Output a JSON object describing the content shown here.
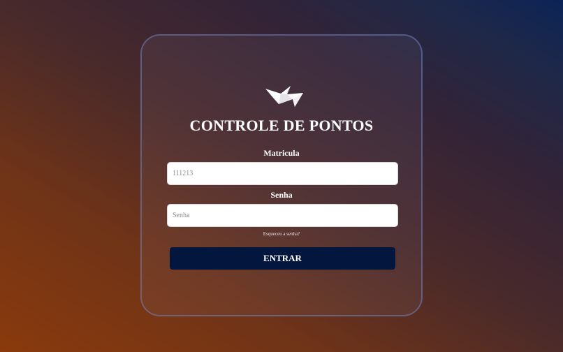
{
  "login": {
    "title": "CONTROLE DE PONTOS",
    "matricula_label": "Matricula",
    "matricula_value": "",
    "matricula_placeholder": "111213",
    "senha_label": "Senha",
    "senha_value": "",
    "senha_placeholder": "Senha",
    "forgot_link": "Esqueceu a senha?",
    "submit_label": "ENTRAR",
    "logo_icon": "paper-bird-logo-icon"
  },
  "colors": {
    "button": "#03163d",
    "card_border": "#6e82be",
    "gradient_start": "#8a3a0c",
    "gradient_end": "#0b2456"
  }
}
